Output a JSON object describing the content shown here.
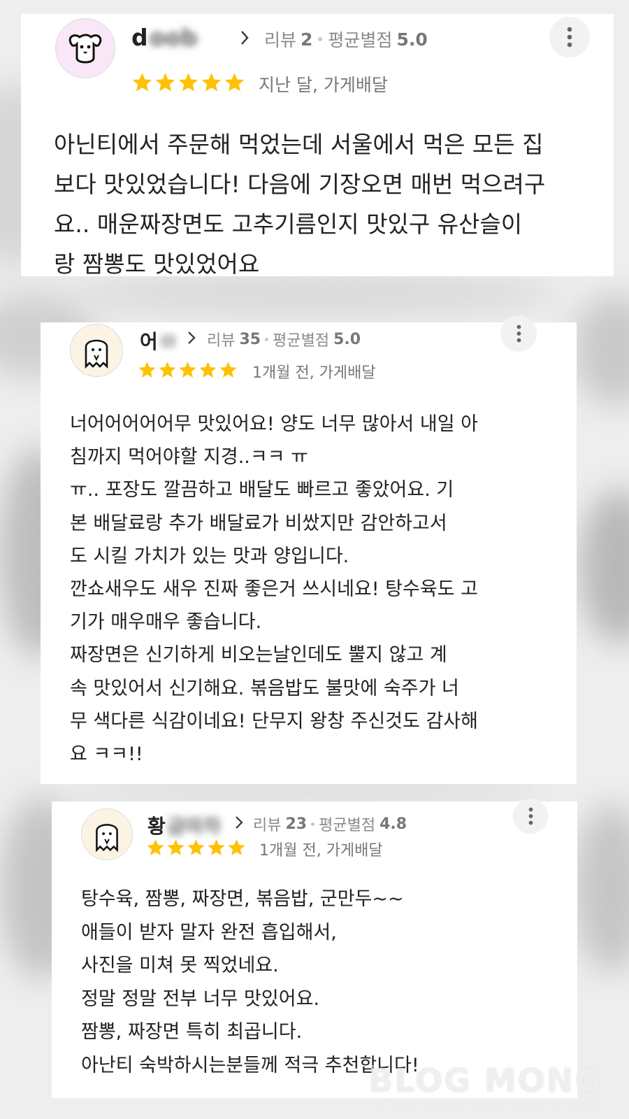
{
  "reviews": [
    {
      "name_visible": "d",
      "name_blurred": "oob",
      "review_count_label": "리뷰",
      "review_count": "2",
      "avg_rating_label": "평균별점",
      "avg_rating": "5.0",
      "stars": 5,
      "time_and_type": "지난 달, 가게배달",
      "text": "아닌티에서 주문해 먹었는데 서울에서 먹은 모든 집\n보다 맛있었습니다! 다음에 기장오면 매번 먹으려구\n요.. 매운짜장면도 고추기름인지 맛있구 유산슬이\n랑 짬뽕도 맛있었어요"
    },
    {
      "name_visible": "어",
      "name_blurred": "ㅁ",
      "review_count_label": "리뷰",
      "review_count": "35",
      "avg_rating_label": "평균별점",
      "avg_rating": "5.0",
      "stars": 5,
      "time_and_type": "1개월 전, 가게배달",
      "text": "너어어어어어무 맛있어요!  양도 너무 많아서 내일 아\n침까지 먹어야할 지경..ㅋㅋ ㅠ\nㅠ.. 포장도 깔끔하고 배달도 빠르고 좋았어요. 기\n본 배달료랑 추가 배달료가 비쌌지만 감안하고서\n도 시킬 가치가 있는 맛과 양입니다.\n깐쇼새우도 새우 진짜 좋은거 쓰시네요! 탕수육도 고\n기가 매우매우 좋습니다.\n짜장면은 신기하게 비오는날인데도 뿔지 않고 계\n속 맛있어서 신기해요. 볶음밥도 불맛에 숙주가 너\n무 색다른 식감이네요! 단무지 왕창 주신것도 감사해\n요 ㅋㅋ!!"
    },
    {
      "name_visible": "황",
      "name_blurred": "금마차",
      "review_count_label": "리뷰",
      "review_count": "23",
      "avg_rating_label": "평균별점",
      "avg_rating": "4.8",
      "stars": 5,
      "time_and_type": "1개월 전, 가게배달",
      "text": "탕수육, 짬뽕, 짜장면, 볶음밥, 군만두~~\n애들이 받자 말자 완전 흡입해서,\n사진을 미쳐 못 찍었네요.\n정말 정말 전부 너무 맛있어요.\n짬뽕, 짜장면 특히 최곱니다.\n아난티 숙박하시는분들께 적극 추천합니다!"
    }
  ],
  "watermark": {
    "title": "BLOG MONG",
    "url": "https://blog.naver.com/lyr5622"
  },
  "colors": {
    "star": "#FFC107",
    "text": "#222222",
    "meta": "#8A8A8A"
  },
  "icons": {
    "avatar_1": "dog-avatar-icon",
    "avatar_2": "ghost-avatar-icon",
    "avatar_3": "ghost-avatar-icon",
    "chevron": "chevron-right-icon",
    "menu": "more-vertical-icon",
    "star": "star-icon"
  }
}
